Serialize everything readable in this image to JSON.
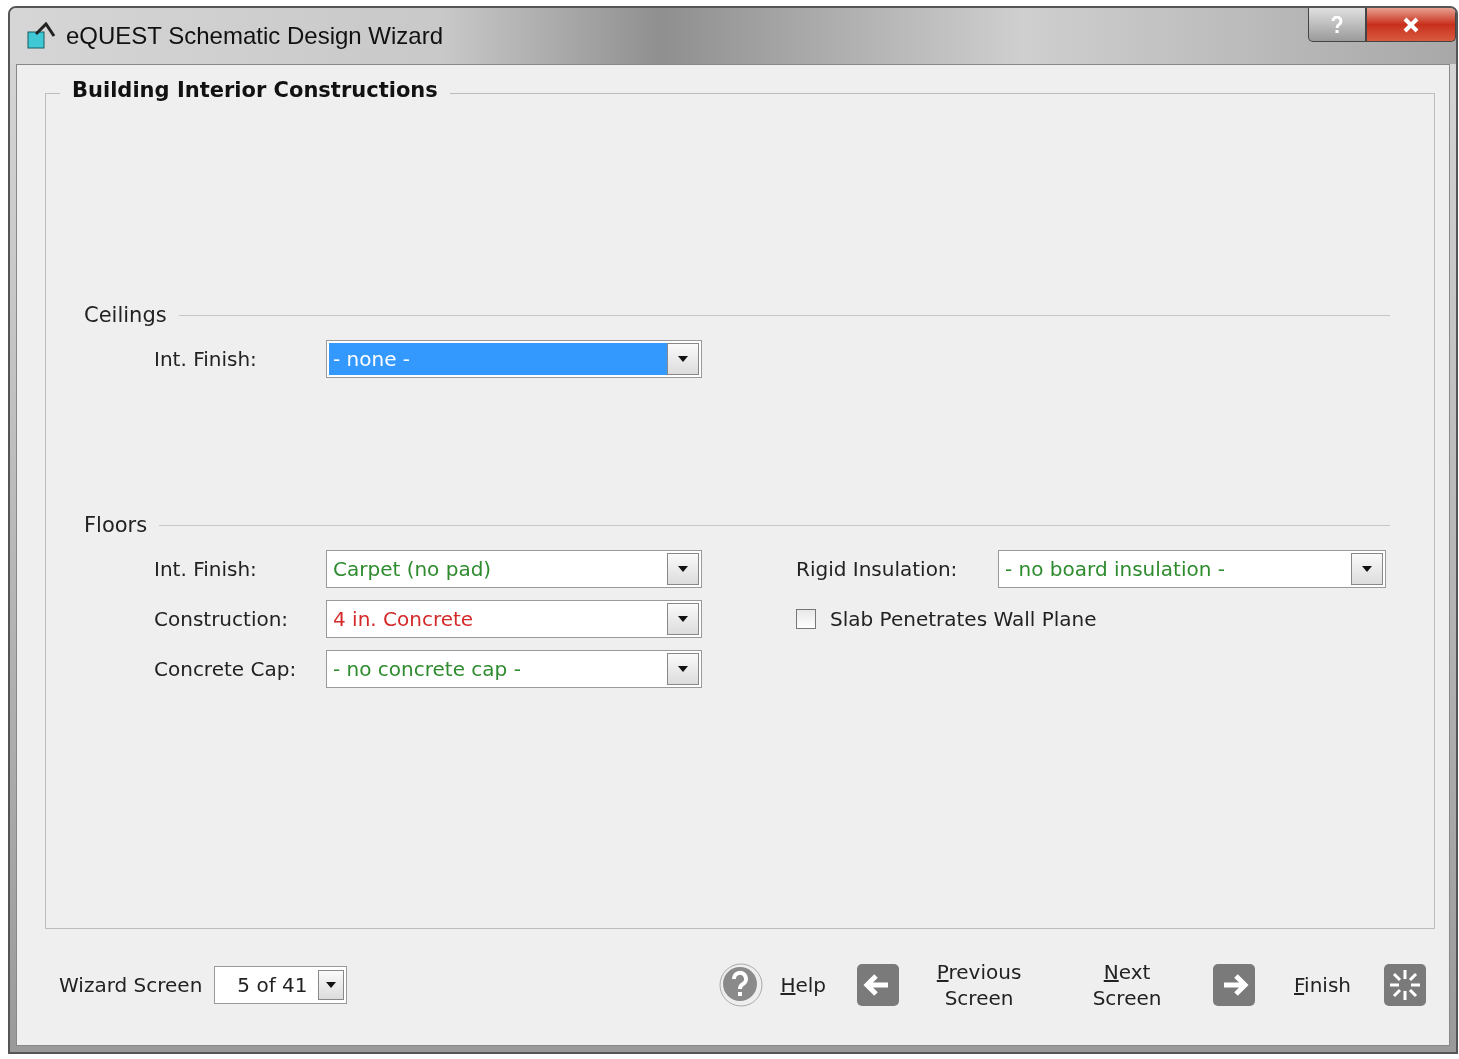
{
  "window": {
    "title": "eQUEST Schematic Design Wizard"
  },
  "group": {
    "title": "Building Interior Constructions"
  },
  "ceilings": {
    "title": "Ceilings",
    "fields": [
      {
        "label": "Int. Finish:",
        "value": "- none -",
        "color": "#ffffff",
        "selected": true
      }
    ]
  },
  "floors": {
    "title": "Floors",
    "fields": [
      {
        "label": "Int. Finish:",
        "value": "Carpet (no pad)",
        "color": "#2e8b2e",
        "selected": false
      },
      {
        "label": "Construction:",
        "value": "4 in. Concrete",
        "color": "#d42a2a",
        "selected": false
      },
      {
        "label": "Concrete Cap:",
        "value": "- no concrete cap -",
        "color": "#2e8b2e",
        "selected": false
      }
    ],
    "rigid_insulation": {
      "label": "Rigid Insulation:",
      "value": "- no board insulation -",
      "color": "#2e8b2e",
      "selected": false
    },
    "slab_checkbox": {
      "label": "Slab Penetrates Wall Plane",
      "checked": false
    }
  },
  "footer": {
    "wizard_screen": {
      "label": "Wizard Screen",
      "value": "5 of 41"
    },
    "buttons": [
      {
        "kind": "help",
        "label": "Help",
        "mnemonic_underlined": true
      },
      {
        "kind": "previous",
        "label": "Previous Screen",
        "mnemonic_underlined": true
      },
      {
        "kind": "next",
        "label": "Next Screen",
        "mnemonic_underlined": true
      },
      {
        "kind": "finish",
        "label": "Finish",
        "mnemonic_underlined": true
      }
    ]
  }
}
